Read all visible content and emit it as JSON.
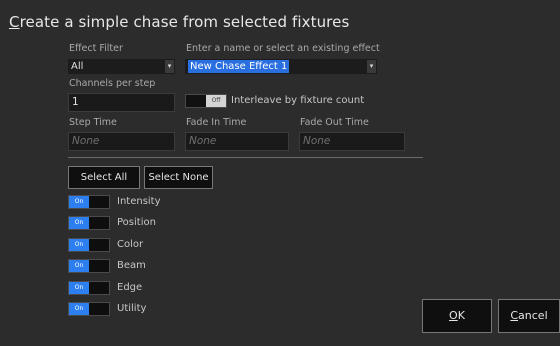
{
  "dialog": {
    "title_prefix": "C",
    "title_rest": "reate a simple chase from selected fixtures"
  },
  "effect_filter": {
    "label": "Effect Filter",
    "value": "All"
  },
  "effect_name": {
    "label": "Enter a name or select an existing effect",
    "value": "New Chase Effect 1"
  },
  "channels_per_step": {
    "label": "Channels per step",
    "value": "1"
  },
  "interleave": {
    "state": "Off",
    "label": "Interleave by fixture count"
  },
  "timing": {
    "step_label": "Step Time",
    "step_placeholder": "None",
    "fade_in_label": "Fade In Time",
    "fade_in_placeholder": "None",
    "fade_out_label": "Fade Out Time",
    "fade_out_placeholder": "None"
  },
  "selection": {
    "select_all": "Select All",
    "select_none": "Select None"
  },
  "attributes": [
    {
      "state": "On",
      "label": "Intensity"
    },
    {
      "state": "On",
      "label": "Position"
    },
    {
      "state": "On",
      "label": "Color"
    },
    {
      "state": "On",
      "label": "Beam"
    },
    {
      "state": "On",
      "label": "Edge"
    },
    {
      "state": "On",
      "label": "Utility"
    }
  ],
  "footer": {
    "ok_underline": "O",
    "ok_rest": "K",
    "cancel_underline": "C",
    "cancel_rest": "ancel"
  },
  "colors": {
    "accent": "#2d7ff0",
    "background": "#2c2c2c"
  }
}
